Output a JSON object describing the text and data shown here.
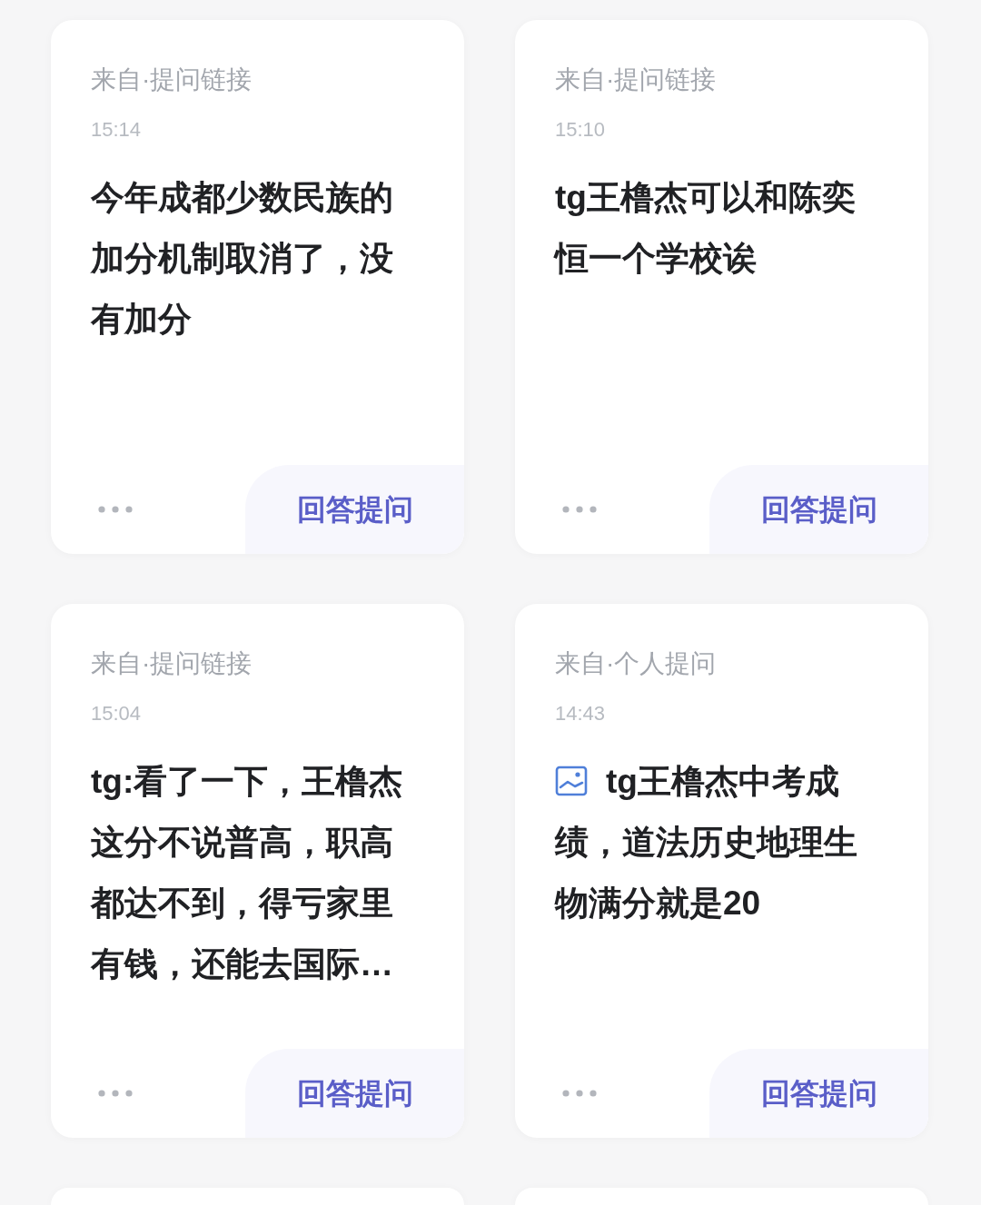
{
  "cards": [
    {
      "kind": "question",
      "source": "来自·提问链接",
      "time": "15:14",
      "has_image": false,
      "text": "今年成都少数民族的加分机制取消了，没有加分",
      "action": "回答提问"
    },
    {
      "kind": "question",
      "source": "来自·提问链接",
      "time": "15:10",
      "has_image": false,
      "text": "tg王橹杰可以和陈奕恒一个学校诶",
      "action": "回答提问"
    },
    {
      "kind": "question",
      "source": "来自·提问链接",
      "time": "15:04",
      "has_image": false,
      "text": "tg:看了一下，王橹杰这分不说普高，职高都达不到，得亏家里有钱，还能去国际…",
      "action": "回答提问"
    },
    {
      "kind": "question",
      "source": "来自·个人提问",
      "time": "14:43",
      "has_image": true,
      "text": "tg王橹杰中考成绩，道法历史地理生物满分就是20",
      "action": "回答提问"
    },
    {
      "kind": "cut_off"
    },
    {
      "kind": "cut_off"
    }
  ]
}
